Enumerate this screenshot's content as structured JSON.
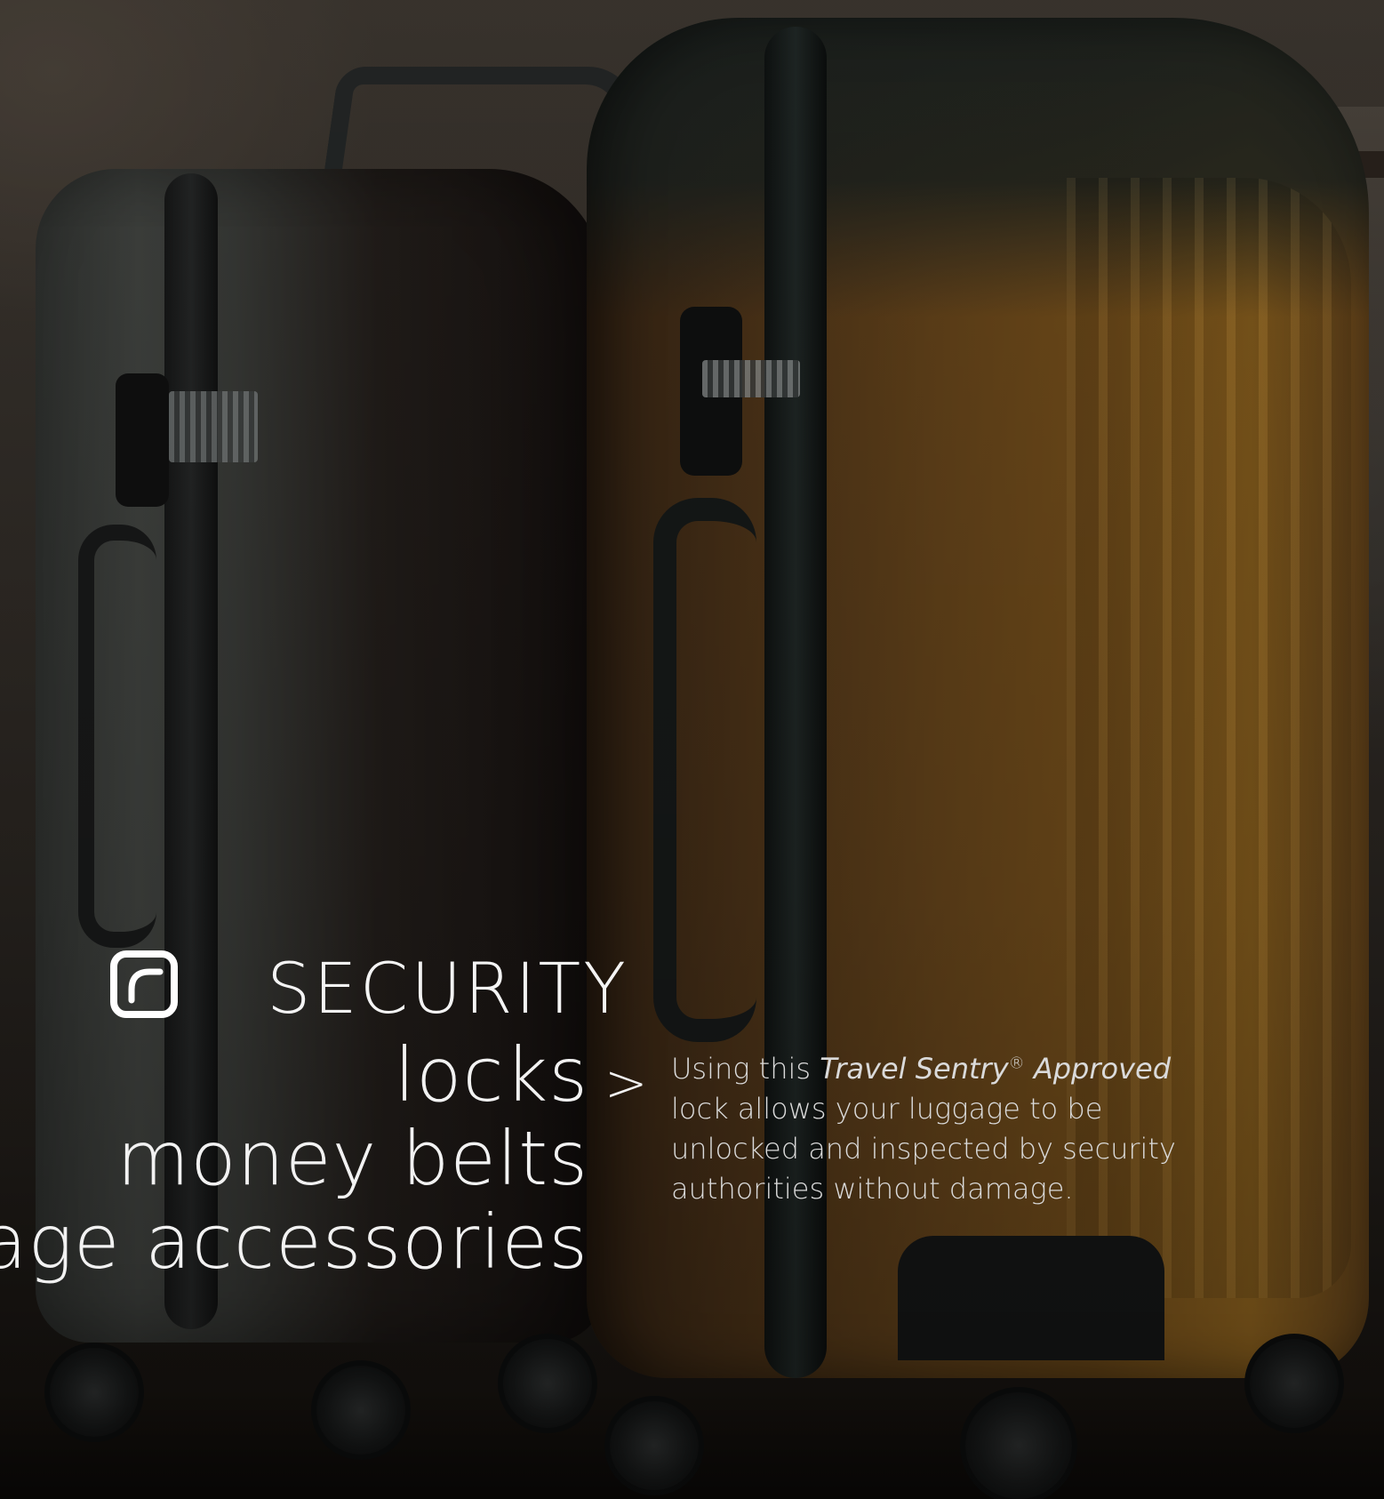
{
  "hero": {
    "cut_off_left_text": "s",
    "section_title": "SECURITY",
    "brand_icon": "rounded-square-corner-icon",
    "categories": [
      {
        "label": "locks"
      },
      {
        "label": "money belts"
      },
      {
        "label": "luggage accessories"
      }
    ],
    "selected_arrow": ">",
    "description": {
      "intro": "Using this ",
      "brand_italic": "Travel Sentry",
      "registered_mark": "®",
      "approved_italic": " Approved",
      "rest": "lock allows your luggage to be unlocked and inspected by security authorities without damage."
    }
  },
  "colors": {
    "text": "#f2f2f2",
    "description_text": "#dadada",
    "suitcase_orange": "#8d5f20",
    "suitcase_grey": "#4f524e"
  }
}
